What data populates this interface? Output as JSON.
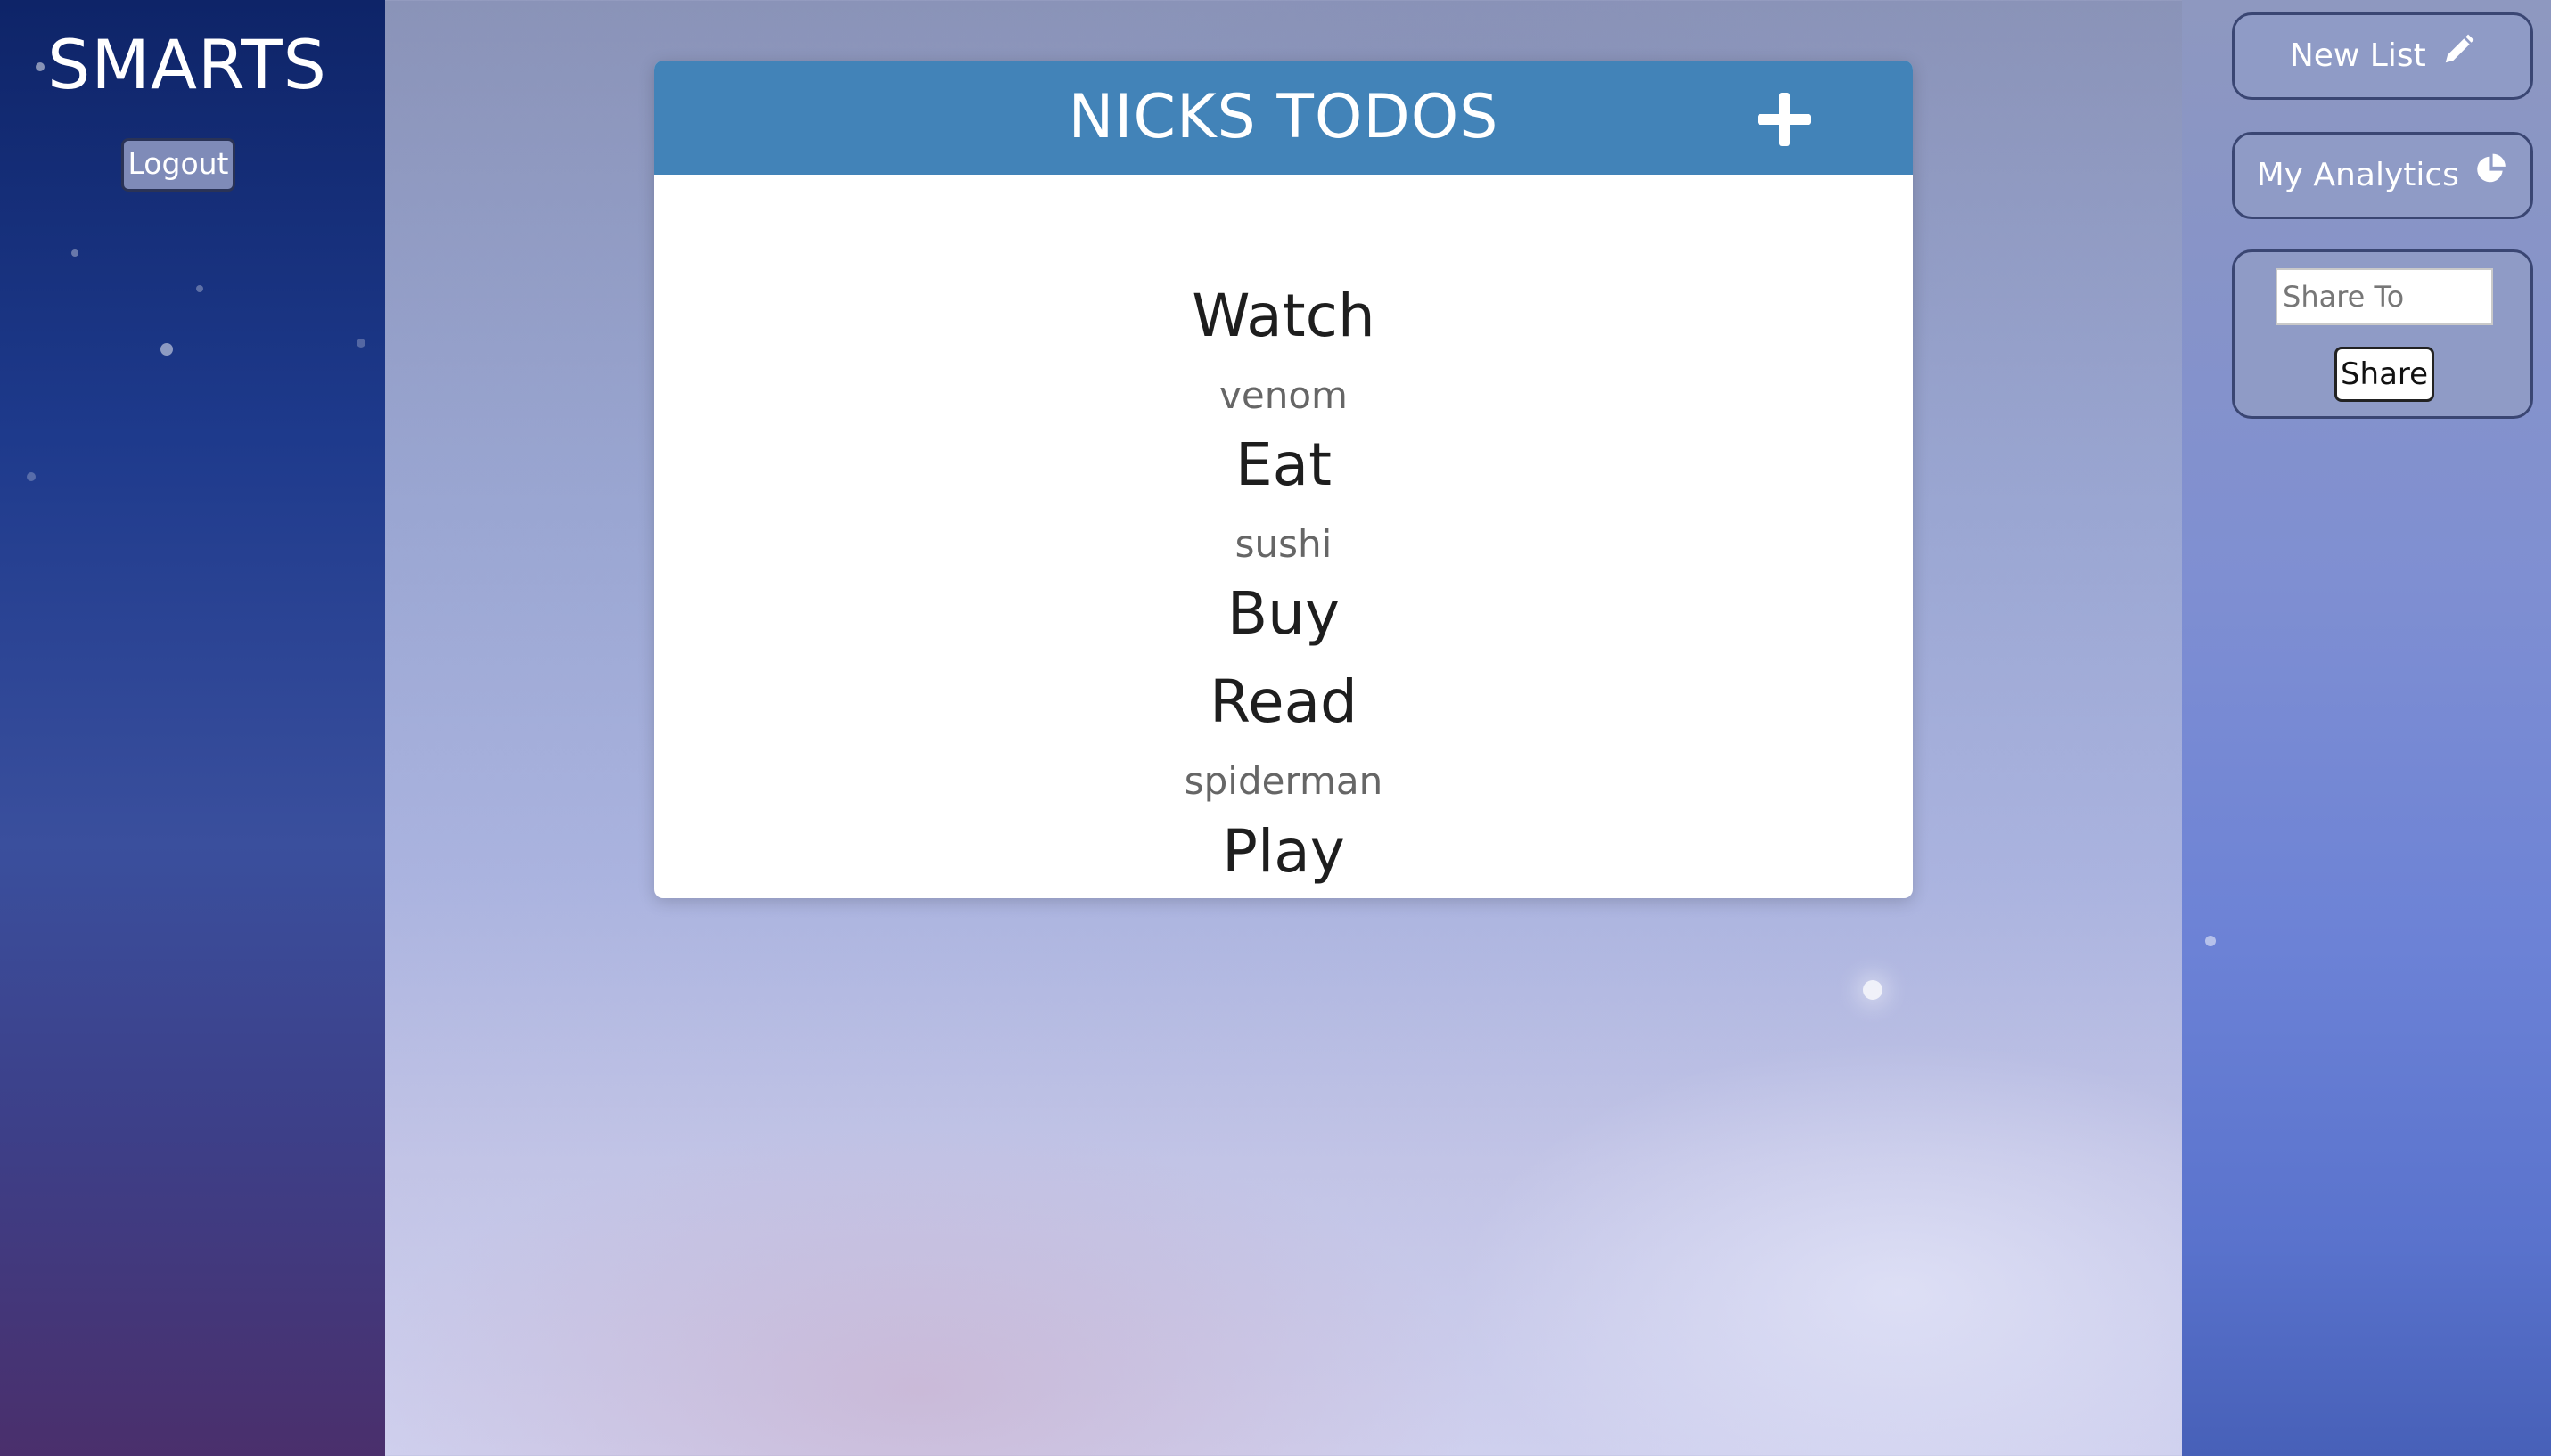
{
  "brand": "SMARTS",
  "logout_label": "Logout",
  "list": {
    "title": "NICKS TODOS",
    "add_icon": "plus-icon",
    "items": [
      {
        "label": "Watch",
        "sub": "venom"
      },
      {
        "label": "Eat",
        "sub": "sushi"
      },
      {
        "label": "Buy",
        "sub": ""
      },
      {
        "label": "Read",
        "sub": "spiderman"
      },
      {
        "label": "Play",
        "sub": ""
      }
    ]
  },
  "sidebar": {
    "new_list_label": "New List",
    "new_list_icon": "pencil-icon",
    "analytics_label": "My Analytics",
    "analytics_icon": "pie-chart-icon",
    "share_placeholder": "Share To",
    "share_value": "",
    "share_button_label": "Share"
  },
  "colors": {
    "header_blue": "#4283b8",
    "left_panel_top": "#0e2468",
    "card_bg": "#ffffff"
  }
}
